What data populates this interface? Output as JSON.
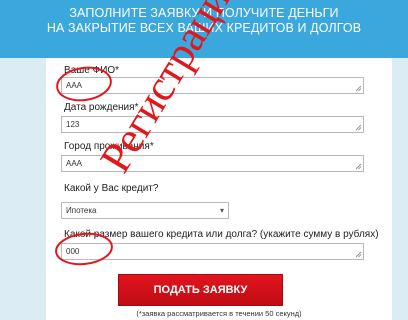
{
  "banner": {
    "line1": "ЗАПОЛНИТЕ ЗАЯВКУ И ПОЛУЧИТЕ ДЕНЬГИ",
    "line2": "НА ЗАКРЫТИЕ ВСЕХ ВАШИХ КРЕДИТОВ И ДОЛГОВ"
  },
  "form": {
    "fio_label": "Ваше ФИО",
    "fio_value": "ААА",
    "dob_label": "Дата рождения",
    "dob_value": "123",
    "city_label": "Город проживания",
    "city_value": "ААА",
    "credit_type_label": "Какой у Вас кредит?",
    "credit_type_value": "Ипотека",
    "amount_label": "Какой размер вашего кредита или долга? (укажите сумму в рублях)",
    "amount_value": "000",
    "required_mark": "*"
  },
  "submit": {
    "label": "ПОДАТЬ ЗАЯВКУ",
    "note": "(*заявка рассматривается в течении 50 секунд)"
  },
  "stamp": {
    "text": "Регистрации НЕТ!",
    "color": "#e0181e"
  },
  "colors": {
    "banner": "#3aa7dd",
    "button": "#d41119"
  }
}
